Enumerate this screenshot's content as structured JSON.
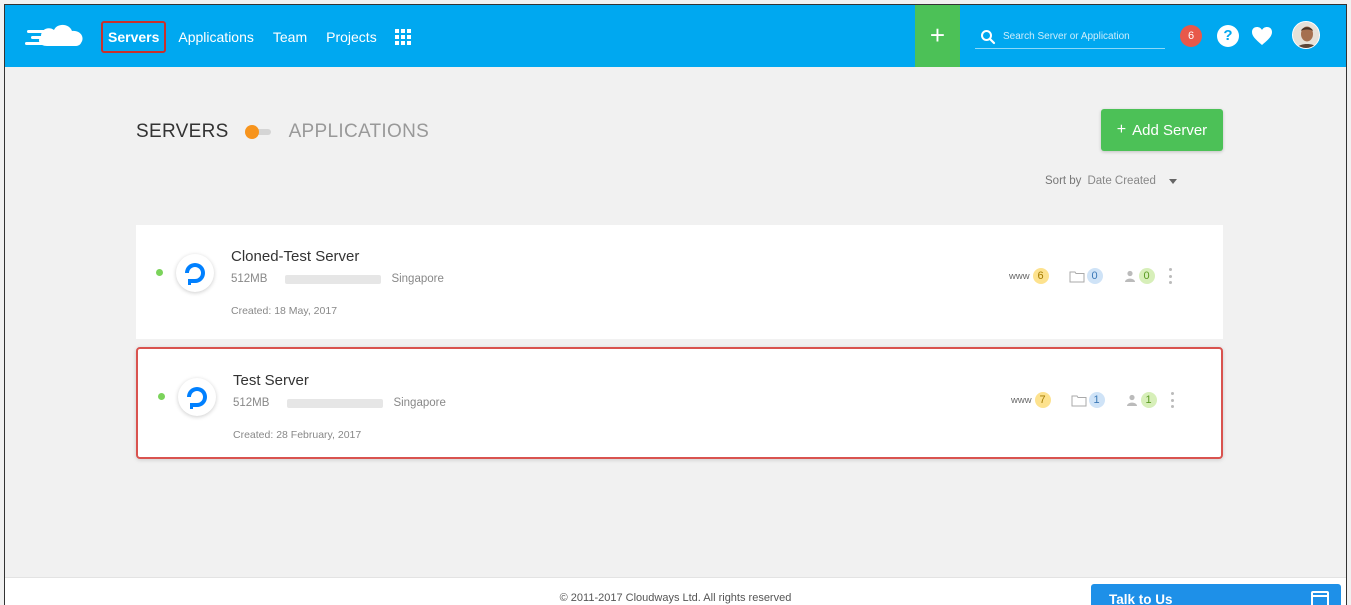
{
  "nav": {
    "items": [
      {
        "label": "Servers",
        "active": true
      },
      {
        "label": "Applications"
      },
      {
        "label": "Team"
      },
      {
        "label": "Projects"
      }
    ]
  },
  "search": {
    "placeholder": "Search Server or Application"
  },
  "notifications": {
    "count": "6"
  },
  "help": {
    "label": "?"
  },
  "page": {
    "toggle_left": "SERVERS",
    "toggle_right": "APPLICATIONS",
    "add_button": "+ Add Server",
    "add_button_text": "Add Server",
    "sort_label": "Sort by",
    "sort_value": "Date Created"
  },
  "servers": [
    {
      "name": "Cloned-Test Server",
      "size": "512MB",
      "location": "Singapore",
      "created": "Created: 18 May, 2017",
      "www_label": "www",
      "apps": "6",
      "folders": "0",
      "users": "0",
      "status_color": "#7bd35b"
    },
    {
      "name": "Test Server",
      "size": "512MB",
      "location": "Singapore",
      "created": "Created: 28 February, 2017",
      "www_label": "www",
      "apps": "7",
      "folders": "1",
      "users": "1",
      "status_color": "#7bd35b"
    }
  ],
  "footer": {
    "copyright": "© 2011-2017 Cloudways Ltd. All rights reserved"
  },
  "chat": {
    "label": "Talk to Us"
  },
  "colors": {
    "topbar": "#00a8f0",
    "accent_green": "#4cc157",
    "highlight_red": "#d9534f",
    "toggle_orange": "#f7941d"
  }
}
